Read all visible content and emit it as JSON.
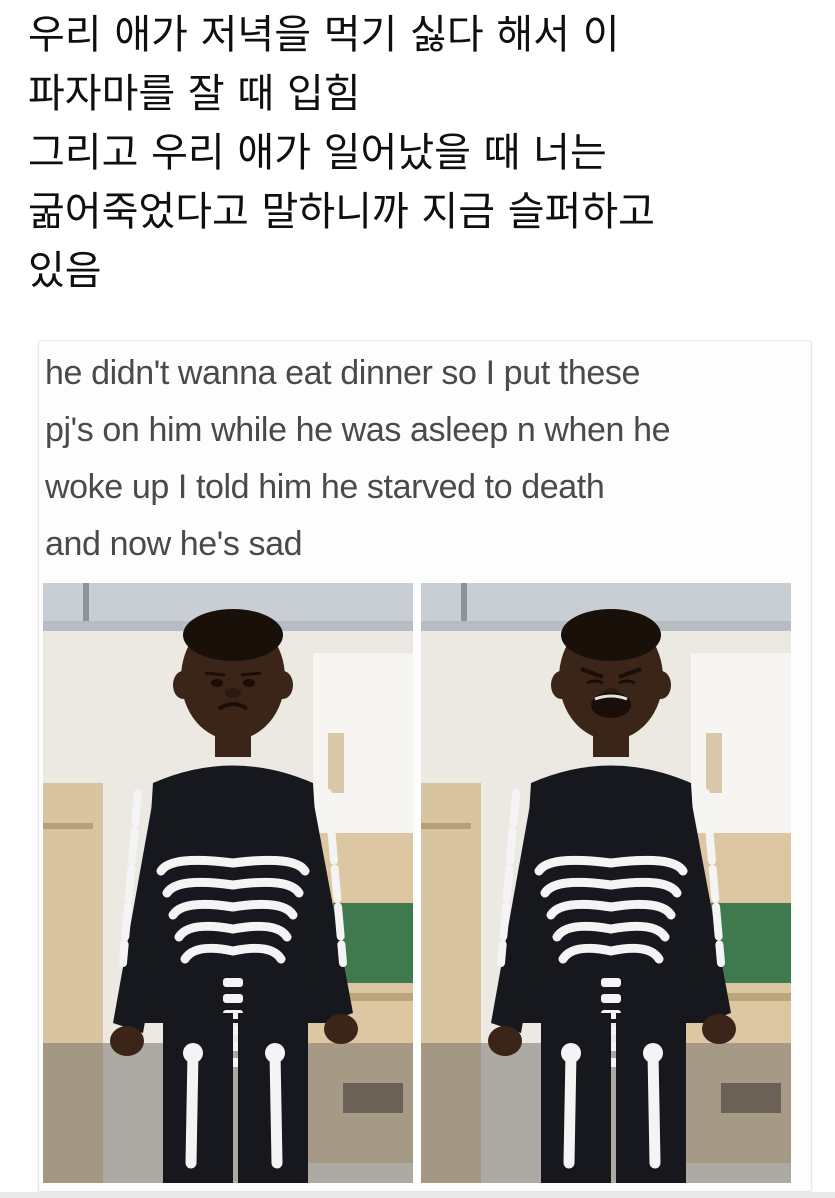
{
  "korean_caption": {
    "lines": [
      "우리 애가 저녁을 먹기 싫다 해서 이",
      "파자마를 잘 때 입힘",
      "그리고 우리 애가 일어났을 때 너는",
      "굶어죽었다고 말하니까 지금 슬퍼하고",
      "있음"
    ]
  },
  "post": {
    "text_lines": [
      "he didn't wanna eat dinner so I put these",
      "pj's on him while he was asleep n when he",
      "woke up I told him he starved to death",
      "and now he's sad"
    ]
  },
  "photos": [
    {
      "name": "photo-left",
      "expression": "sad"
    },
    {
      "name": "photo-right",
      "expression": "crying"
    }
  ],
  "colors": {
    "caption_text": "#0f0f0f",
    "post_text": "#4a4a4a",
    "pajama": "#16181d",
    "bones": "#f4f4f4",
    "skin": "#3a2518",
    "wall": "#ece9e3"
  }
}
